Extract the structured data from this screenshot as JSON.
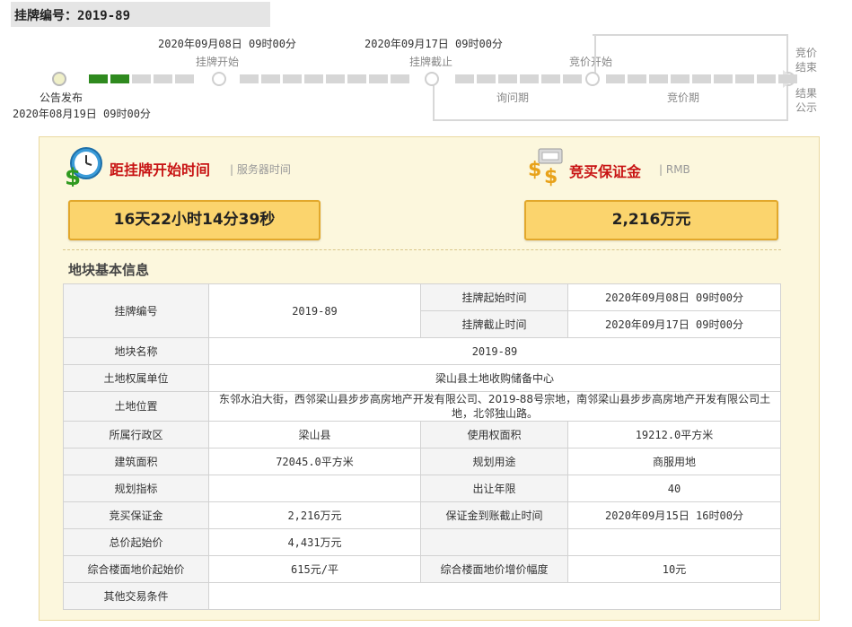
{
  "header": {
    "title": "挂牌编号：2019-89"
  },
  "timeline": {
    "listing_start_date": "2020年09月08日 09时00分",
    "listing_start_label": "挂牌开始",
    "listing_end_date": "2020年09月17日 09时00分",
    "listing_end_label": "挂牌截止",
    "bid_start_label": "竞价开始",
    "bid_end_label_1": "竞价",
    "bid_end_label_2": "结束",
    "result_label_1": "结果",
    "result_label_2": "公示",
    "inquiry_period": "询问期",
    "bidding_period": "竞价期",
    "announce_label": "公告发布",
    "announce_date": "2020年08月19日 09时00分"
  },
  "countdown": {
    "title": "距挂牌开始时间",
    "subtitle": "| 服务器时间",
    "value": "16天22小时14分39秒"
  },
  "deposit": {
    "title": "竞买保证金",
    "subtitle": "| RMB",
    "value": "2,216万元"
  },
  "info": {
    "title": "地块基本信息",
    "listing_no_label": "挂牌编号",
    "listing_no": "2019-89",
    "listing_start_label": "挂牌起始时间",
    "listing_start": "2020年09月08日 09时00分",
    "listing_end_label": "挂牌截止时间",
    "listing_end": "2020年09月17日 09时00分",
    "parcel_name_label": "地块名称",
    "parcel_name": "2019-89",
    "owner_label": "土地权属单位",
    "owner": "梁山县土地收购储备中心",
    "location_label": "土地位置",
    "location": "东邻水泊大街，西邻梁山县步步高房地产开发有限公司、2019-88号宗地，南邻梁山县步步高房地产开发有限公司土地，北邻独山路。",
    "district_label": "所属行政区",
    "district": "梁山县",
    "use_area_label": "使用权面积",
    "use_area": "19212.0平方米",
    "build_area_label": "建筑面积",
    "build_area": "72045.0平方米",
    "plan_use_label": "规划用途",
    "plan_use": "商服用地",
    "plan_index_label": "规划指标",
    "plan_index": "",
    "term_label": "出让年限",
    "term": "40",
    "deposit_label": "竞买保证金",
    "deposit": "2,216万元",
    "deposit_deadline_label": "保证金到账截止时间",
    "deposit_deadline": "2020年09月15日 16时00分",
    "start_price_label": "总价起始价",
    "start_price": "4,431万元",
    "floor_price_label": "综合楼面地价起始价",
    "floor_price": "615元/平",
    "increment_label": "综合楼面地价增价幅度",
    "increment": "10元",
    "other_label": "其他交易条件",
    "other": ""
  },
  "colors": {
    "accent_red": "#c81414",
    "progress_green": "#2f8a1f",
    "box_yellow": "#fbd46d"
  }
}
